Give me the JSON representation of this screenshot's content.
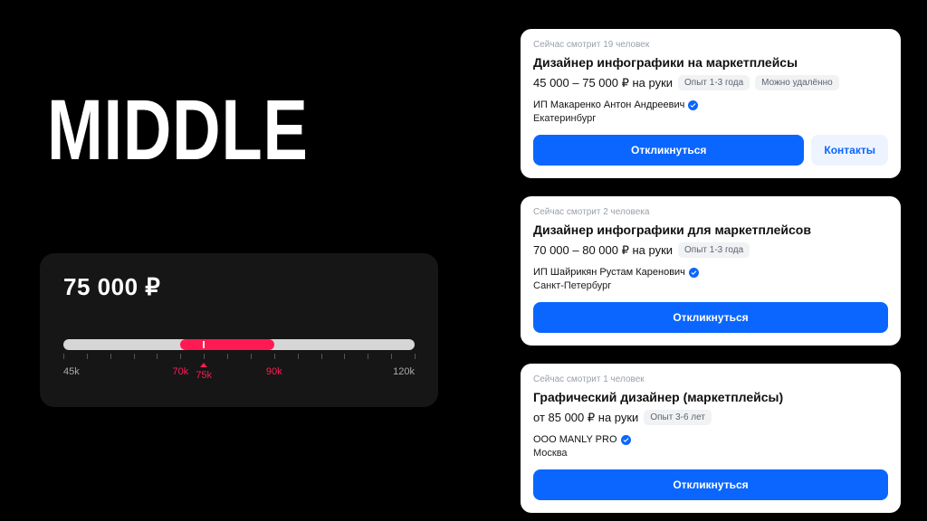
{
  "title": "MIDDLE",
  "slider": {
    "value_display": "75 000 ₽",
    "min": 45,
    "max": 120,
    "range_from": 70,
    "range_to": 90,
    "pointer": 75,
    "pointer_label": "75k",
    "labels": {
      "min": "45k",
      "from": "70k",
      "to": "90k",
      "max": "120k"
    }
  },
  "cards": [
    {
      "meta": "Сейчас смотрит 19 человек",
      "title": "Дизайнер инфографики на маркетплейсы",
      "salary": "45 000 – 75 000 ₽ на руки",
      "chips": [
        "Опыт 1-3 года",
        "Можно удалённо"
      ],
      "employer": "ИП Макаренко Антон Андреевич",
      "verified": true,
      "city": "Екатеринбург",
      "apply": "Откликнуться",
      "contacts": "Контакты",
      "has_contacts": true
    },
    {
      "meta": "Сейчас смотрит 2 человека",
      "title": "Дизайнер инфографики для маркетплейсов",
      "salary": "70 000 – 80 000 ₽ на руки",
      "chips": [
        "Опыт 1-3 года"
      ],
      "employer": "ИП Шайрикян Рустам Каренович",
      "verified": true,
      "city": "Санкт-Петербург",
      "apply": "Откликнуться",
      "has_contacts": false
    },
    {
      "meta": "Сейчас смотрит 1 человек",
      "title": "Графический дизайнер (маркетплейсы)",
      "salary": "от 85 000 ₽ на руки",
      "chips": [
        "Опыт 3-6 лет"
      ],
      "employer": "ООО MANLY PRO",
      "verified": true,
      "city": "Москва",
      "apply": "Откликнуться",
      "has_contacts": false
    }
  ]
}
